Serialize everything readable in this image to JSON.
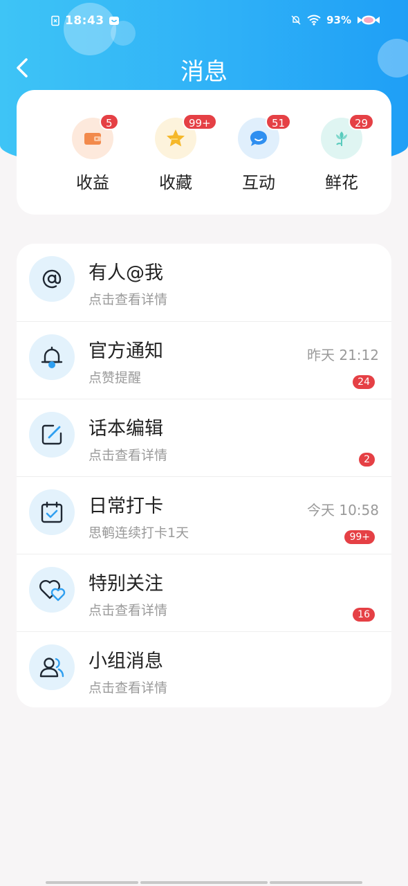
{
  "status_bar": {
    "time": "18:43",
    "battery": "93%"
  },
  "nav": {
    "title": "消息"
  },
  "top_items": [
    {
      "label": "收益",
      "badge": "5",
      "icon": "wallet-icon",
      "bg": "#fde9dc",
      "color": "#f28a4c"
    },
    {
      "label": "收藏",
      "badge": "99+",
      "icon": "star-icon",
      "bg": "#fdf3dc",
      "color": "#f5b82a"
    },
    {
      "label": "互动",
      "badge": "51",
      "icon": "chat-bubble-icon",
      "bg": "#e0effc",
      "color": "#2f8ff0"
    },
    {
      "label": "鲜花",
      "badge": "29",
      "icon": "flower-icon",
      "bg": "#dff5f2",
      "color": "#59cbbd"
    }
  ],
  "list": [
    {
      "title": "有人@我",
      "subtitle": "点击查看详情",
      "time": "",
      "badge": "",
      "icon": "at-sign-icon"
    },
    {
      "title": "官方通知",
      "subtitle": "点赞提醒",
      "time": "昨天 21:12",
      "badge": "24",
      "icon": "bell-icon"
    },
    {
      "title": "话本编辑",
      "subtitle": "点击查看详情",
      "time": "",
      "badge": "2",
      "icon": "edit-icon"
    },
    {
      "title": "日常打卡",
      "subtitle": "思鹌连续打卡1天",
      "time": "今天 10:58",
      "badge": "99+",
      "icon": "calendar-check-icon"
    },
    {
      "title": "特别关注",
      "subtitle": "点击查看详情",
      "time": "",
      "badge": "16",
      "icon": "hearts-icon"
    },
    {
      "title": "小组消息",
      "subtitle": "点击查看详情",
      "time": "",
      "badge": "",
      "icon": "group-icon"
    }
  ],
  "colors": {
    "accent": "#2fb1f7",
    "badge": "#e54045",
    "icon_bg": "#e3f2fc",
    "icon_blue": "#2f9ff0"
  }
}
